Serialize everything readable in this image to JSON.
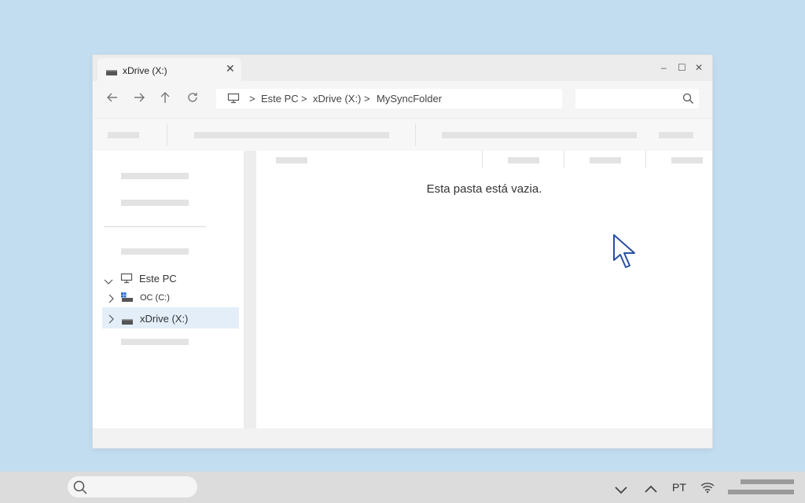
{
  "window": {
    "tab_title": "xDrive (X:)",
    "tab_close": "✕",
    "controls": {
      "minimize": "–",
      "maximize": "☐",
      "close": "✕"
    }
  },
  "toolbar": {
    "back": "←",
    "forward": "→",
    "up": "↑",
    "refresh": "↻",
    "breadcrumb": [
      "Este PC",
      "xDrive (X:)",
      "MySyncFolder"
    ],
    "separator": ">",
    "search_placeholder": ""
  },
  "content": {
    "empty_message": "Esta pasta está vazia."
  },
  "sidebar": {
    "this_pc": "Este PC",
    "drive_c": "OC (C:)",
    "drive_x": "xDrive (X:)",
    "selected_color": "#e3eef9"
  },
  "taskbar": {
    "language": "PT",
    "search_placeholder": ""
  },
  "icons": {
    "back": "arrow-left-icon",
    "forward": "arrow-right-icon",
    "up": "arrow-up-icon",
    "refresh": "refresh-icon",
    "search": "search-icon",
    "computer": "computer-icon",
    "drive": "drive-icon",
    "cursor": "mouse-pointer-icon",
    "wifi": "wifi-icon"
  },
  "colors": {
    "desktop": "#c2ddf0",
    "cursor": "#2a4fa0"
  }
}
